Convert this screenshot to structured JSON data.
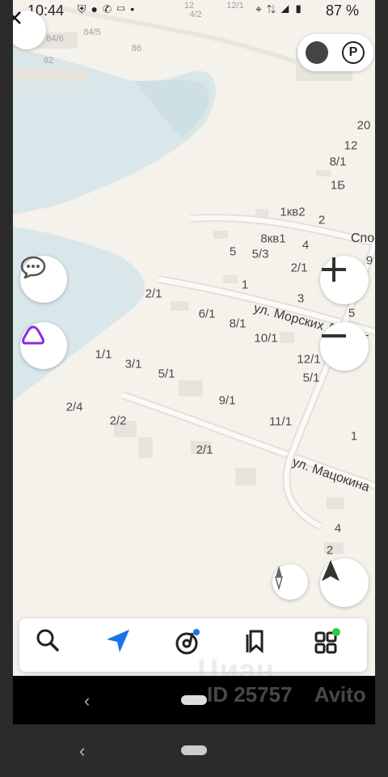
{
  "status_bar": {
    "time": "10:44",
    "battery": "87 %"
  },
  "map": {
    "faint_labels": [
      "84/5",
      "84/6",
      "86",
      "92",
      "12",
      "4/2",
      "12/1"
    ],
    "house_numbers": [
      "20",
      "12",
      "8/1",
      "1Б",
      "1кв2",
      "2",
      "8кв1",
      "4",
      "5",
      "5/3",
      "2/1",
      "9",
      "1",
      "3",
      "5",
      "2/1",
      "6/1",
      "8/1",
      "10/1",
      "12/1",
      "5/1",
      "1/1",
      "3/1",
      "5/1",
      "9/1",
      "11/1",
      "2/4",
      "2/2",
      "2/1",
      "1",
      "4",
      "2"
    ],
    "streets": [
      "ул. Морских Десант",
      "ул. Мацокина",
      "Спо"
    ]
  },
  "watermark": {
    "top": "Циан",
    "id_text": "ID 25757",
    "brand": "Avito"
  },
  "colors": {
    "map_bg": "#f4f2ea",
    "water": "#d8e6ea",
    "accent_blue": "#1a73e8",
    "alice_purple": "#8a2be2",
    "notification_dot_green": "#2ecc40"
  }
}
